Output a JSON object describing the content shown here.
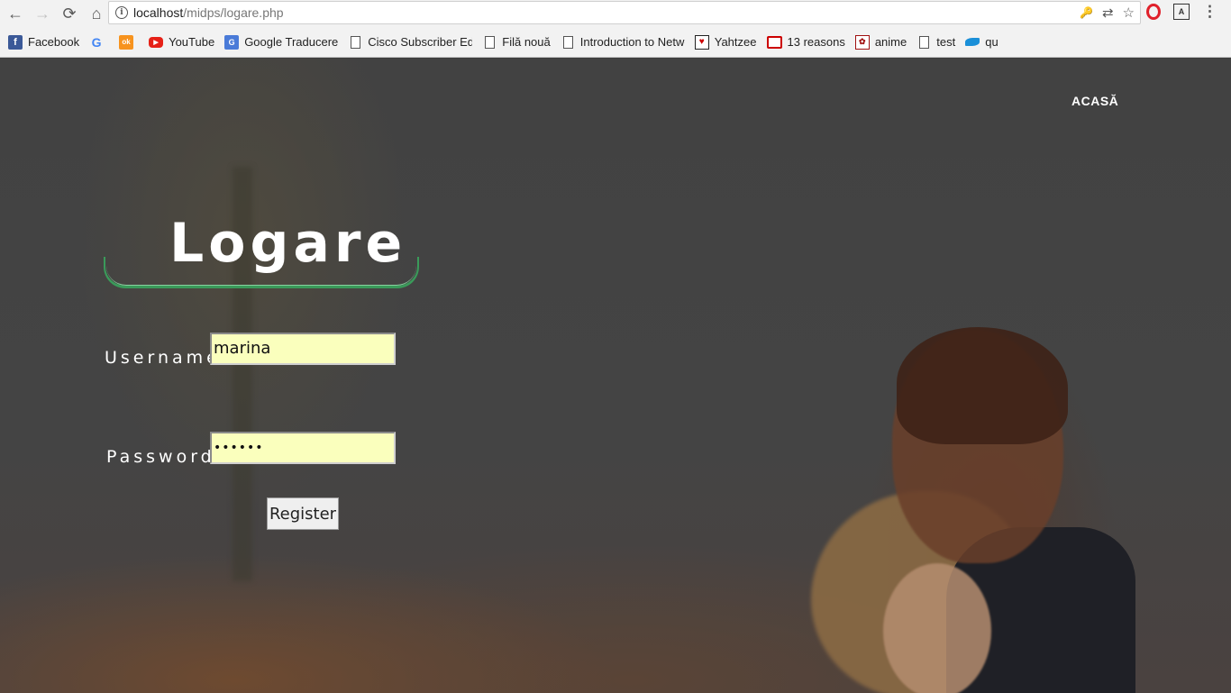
{
  "browser": {
    "url_host": "localhost",
    "url_path": "/midps/logare.php",
    "back_icon": "←",
    "forward_icon": "→",
    "reload_icon": "⟳",
    "home_icon": "⌂",
    "info_icon": "i",
    "key_icon": "🔑",
    "translate_icon": "⇄",
    "star_icon": "☆",
    "ext_label": "A",
    "menu_icon": "⋮"
  },
  "bookmarks": [
    {
      "label": "Facebook",
      "icon": "f"
    },
    {
      "label": "",
      "icon": "G"
    },
    {
      "label": "",
      "icon": "ok"
    },
    {
      "label": "YouTube",
      "icon": "▶"
    },
    {
      "label": "Google Traducere",
      "icon": "G"
    },
    {
      "label": "Cisco Subscriber Edge",
      "icon": ""
    },
    {
      "label": "Filă nouă",
      "icon": ""
    },
    {
      "label": "Introduction to Netwo",
      "icon": ""
    },
    {
      "label": "Yahtzee",
      "icon": "♥"
    },
    {
      "label": "13 reasons",
      "icon": ""
    },
    {
      "label": "anime",
      "icon": "✿"
    },
    {
      "label": "test",
      "icon": ""
    },
    {
      "label": "qu",
      "icon": ""
    }
  ],
  "page": {
    "nav_home": "ACASĂ",
    "title": "Logare",
    "username_label": "Username:",
    "username_value": "marina",
    "password_label": "Password:",
    "password_mask": "••••••",
    "submit_label": "Register"
  }
}
